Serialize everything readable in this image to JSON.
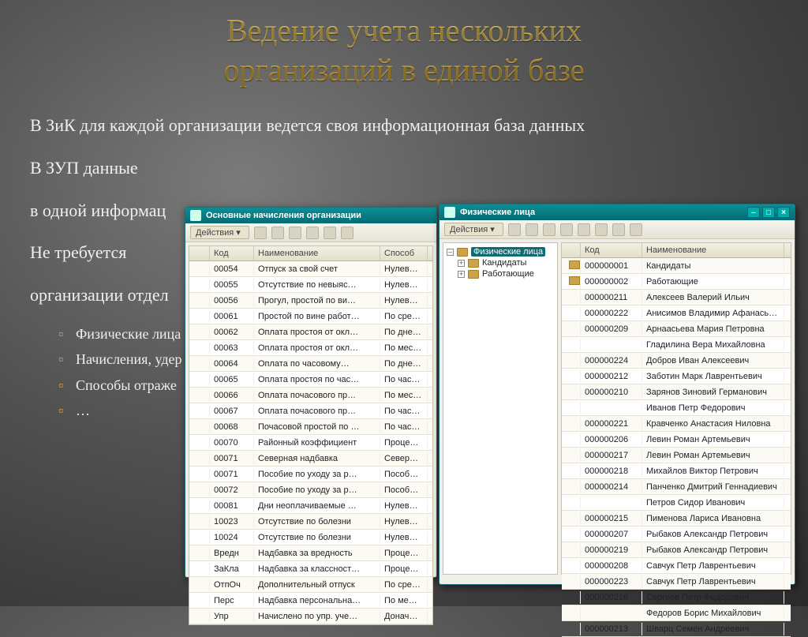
{
  "slide_title_line1": "Ведение учета нескольких",
  "slide_title_line2": "организаций  в единой базе",
  "paragraphs": {
    "p1": "В  ЗиК  для  каждой  организации  ведется  своя информационная база данных",
    "p2": "В ЗУП данные",
    "p3": "в одной информац",
    "p4a": "Не   требуется",
    "p4b": "организации отдел"
  },
  "bullets": [
    "Физические лица",
    "Начисления, удер",
    "Способы отраже",
    "…"
  ],
  "win1": {
    "title": "Основные начисления организации",
    "actions": "Действия ▾",
    "cols": [
      "",
      "Код",
      "Наименование",
      "Способ"
    ],
    "rows": [
      {
        "ico": "mi-blue",
        "code": "00054",
        "name": "Отпуск за свой счет",
        "met": "Нулев…"
      },
      {
        "ico": "mi-blue",
        "code": "00055",
        "name": "Отсутствие по невыяс…",
        "met": "Нулев…"
      },
      {
        "ico": "mi-blue",
        "code": "00056",
        "name": "Прогул, простой по ви…",
        "met": "Нулев…"
      },
      {
        "ico": "mi-blue",
        "code": "00061",
        "name": "Простой по вине работ…",
        "met": "По сре…"
      },
      {
        "ico": "mi-blue",
        "code": "00062",
        "name": "Оплата простоя от окл…",
        "met": "По дне…"
      },
      {
        "ico": "mi-blue",
        "code": "00063",
        "name": "Оплата простоя от окл…",
        "met": "По мес…"
      },
      {
        "ico": "mi-blue",
        "code": "00064",
        "name": "Оплата по часовому…",
        "met": "По дне…"
      },
      {
        "ico": "mi-blue",
        "code": "00065",
        "name": "Оплата простоя по час…",
        "met": "По час…"
      },
      {
        "ico": "mi-blue",
        "code": "00066",
        "name": "Оплата почасового пр…",
        "met": "По мес…"
      },
      {
        "ico": "mi-blue",
        "code": "00067",
        "name": "Оплата почасового пр…",
        "met": "По час…"
      },
      {
        "ico": "mi-blue",
        "code": "00068",
        "name": "Почасовой простой по …",
        "met": "По час…"
      },
      {
        "ico": "mi-blue",
        "code": "00070",
        "name": "Районный коэффициент",
        "met": "Проце…"
      },
      {
        "ico": "mi-blue",
        "code": "00071",
        "name": "Северная надбавка",
        "met": "Север…"
      },
      {
        "ico": "mi-blue",
        "code": "00071",
        "name": "Пособие по уходу за р…",
        "met": "Пособ…"
      },
      {
        "ico": "mi-blue",
        "code": "00072",
        "name": "Пособие по уходу за р…",
        "met": "Пособ…"
      },
      {
        "ico": "mi-blue",
        "code": "00081",
        "name": "Дни неоплачиваемые …",
        "met": "Нулев…"
      },
      {
        "ico": "mi-blue",
        "code": "10023",
        "name": "Отсутствие по болезни",
        "met": "Нулев…"
      },
      {
        "ico": "mi-blue",
        "code": "10024",
        "name": "Отсутствие по болезни",
        "met": "Нулев…"
      },
      {
        "ico": "mi-green",
        "code": "Вредн",
        "name": "Надбавка за вредность",
        "met": "Проце…"
      },
      {
        "ico": "mi-green",
        "code": "ЗаКла",
        "name": "Надбавка за классност…",
        "met": "Проце…"
      },
      {
        "ico": "mi-green",
        "code": "ОтпОч",
        "name": "Дополнительный отпуск",
        "met": "По сре…"
      },
      {
        "ico": "mi-green",
        "code": "Перс",
        "name": "Надбавка персональна…",
        "met": "По ме…"
      },
      {
        "ico": "mi-green",
        "code": "Упр",
        "name": "Начислено по упр. уче…",
        "met": "Донач…"
      }
    ]
  },
  "win2": {
    "title": "Физические лица",
    "actions": "Действия ▾",
    "tree": {
      "root": "Физические лица",
      "children": [
        "Кандидаты",
        "Работающие"
      ]
    },
    "cols": [
      "",
      "Код",
      "Наименование"
    ],
    "rows": [
      {
        "fold": true,
        "code": "000000001",
        "name": "Кандидаты"
      },
      {
        "fold": true,
        "code": "000000002",
        "name": "Работающие"
      },
      {
        "code": "000000211",
        "name": "Алексеев Валерий Ильич"
      },
      {
        "code": "000000222",
        "name": "Анисимов Владимир Афанасьевич"
      },
      {
        "code": "000000209",
        "name": "Арнаасьева Мария Петровна"
      },
      {
        "code": "",
        "name": "Гладилина Вера Михайловна"
      },
      {
        "code": "000000224",
        "name": "Добров Иван Алексеевич"
      },
      {
        "code": "000000212",
        "name": "Заботин Марк Лаврентьевич"
      },
      {
        "code": "000000210",
        "name": "Зарянов Зиновий Германович"
      },
      {
        "code": "",
        "name": "Иванов Петр Федорович"
      },
      {
        "code": "000000221",
        "name": "Кравченко Анастасия Ниловна"
      },
      {
        "code": "000000206",
        "name": "Левин Роман Артемьевич"
      },
      {
        "code": "000000217",
        "name": "Левин Роман Артемьевич"
      },
      {
        "code": "000000218",
        "name": "Михайлов Виктор Петрович"
      },
      {
        "code": "000000214",
        "name": "Панченко Дмитрий Геннадиевич"
      },
      {
        "code": "",
        "name": "Петров Сидор Иванович"
      },
      {
        "code": "000000215",
        "name": "Пименова Лариса Ивановна"
      },
      {
        "code": "000000207",
        "name": "Рыбаков Александр Петрович"
      },
      {
        "code": "000000219",
        "name": "Рыбаков Александр Петрович"
      },
      {
        "code": "000000208",
        "name": "Савчук Петр Лаврентьевич"
      },
      {
        "code": "000000223",
        "name": "Савчук Петр Лаврентьевич"
      },
      {
        "code": "000000216",
        "name": "Сергеев Петр Федорович"
      },
      {
        "code": "",
        "name": "Федоров Борис Михайлович"
      },
      {
        "code": "000000213",
        "name": "Шварц Семен Андреевич"
      }
    ]
  }
}
